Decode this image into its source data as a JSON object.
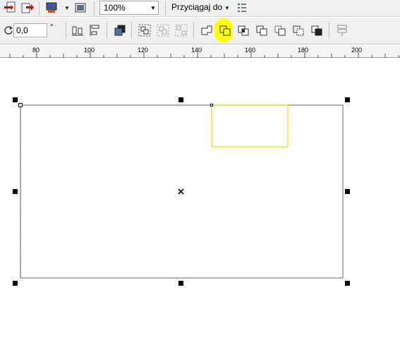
{
  "toolbar1": {
    "zoom_value": "100%",
    "snap_label": "Przyciągaj do"
  },
  "toolbar2": {
    "rotation_value": "0,0",
    "rotation_unit": "°"
  },
  "ruler": {
    "labels": [
      "80",
      "100",
      "120",
      "140",
      "160",
      "180",
      "200"
    ]
  },
  "icons": [
    "import-icon",
    "export-icon",
    "application-launcher-icon",
    "welcome-screen-icon",
    "snap-options-icon",
    "rotate-icon",
    "align-icon",
    "distribute-icon",
    "order-icon",
    "group-icon",
    "ungroup-icon",
    "ungroup-all-icon",
    "weld-icon",
    "trim-icon",
    "intersect-icon",
    "simplify-icon",
    "front-minus-back-icon",
    "back-minus-front-icon",
    "create-boundary-icon",
    "reverse-order-icon"
  ],
  "colors": {
    "highlight": "#ffff00",
    "selected_outline": "#e6e600"
  }
}
